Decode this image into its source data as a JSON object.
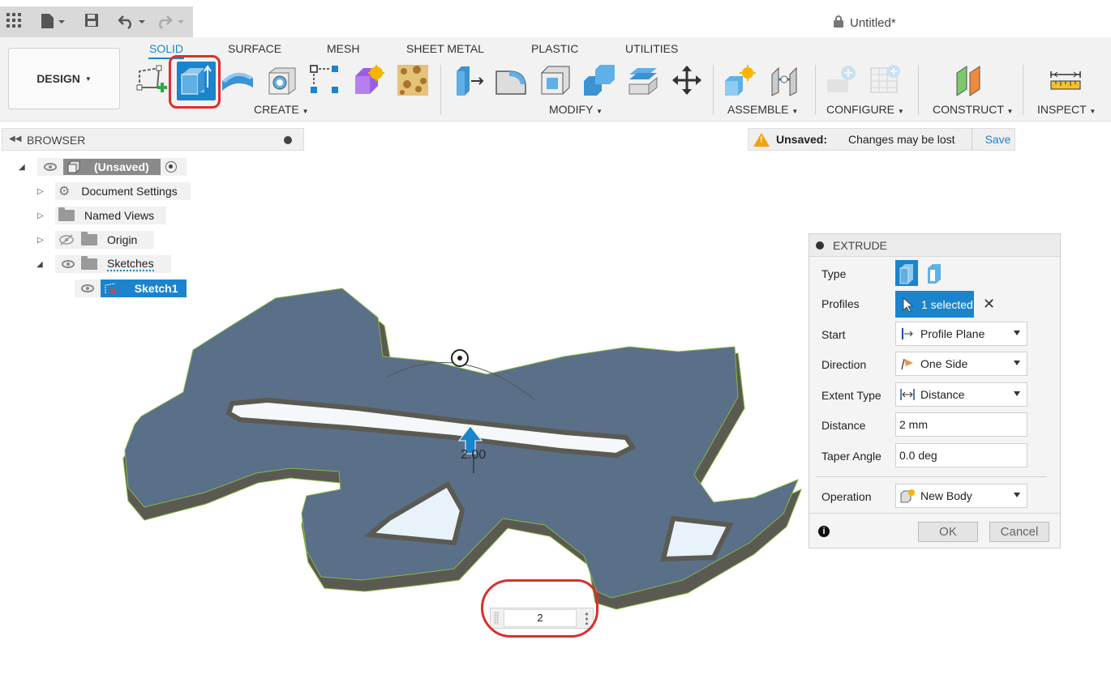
{
  "window": {
    "title": "Untitled*"
  },
  "ribbon": {
    "workspace_label": "DESIGN",
    "tabs": [
      {
        "label": "SOLID",
        "active": true
      },
      {
        "label": "SURFACE"
      },
      {
        "label": "MESH"
      },
      {
        "label": "SHEET METAL"
      },
      {
        "label": "PLASTIC"
      },
      {
        "label": "UTILITIES"
      }
    ],
    "groups": {
      "create": "CREATE",
      "modify": "MODIFY",
      "assemble": "ASSEMBLE",
      "configure": "CONFIGURE",
      "construct": "CONSTRUCT",
      "inspect": "INSPECT"
    }
  },
  "browser": {
    "title": "BROWSER",
    "items": [
      {
        "label": "(Unsaved)"
      },
      {
        "label": "Document Settings"
      },
      {
        "label": "Named Views"
      },
      {
        "label": "Origin"
      },
      {
        "label": "Sketches"
      },
      {
        "label": "Sketch1"
      }
    ]
  },
  "unsaved_bar": {
    "status": "Unsaved:",
    "message": "Changes may be lost",
    "save_label": "Save"
  },
  "extrude": {
    "title": "EXTRUDE",
    "type_label": "Type",
    "profiles_label": "Profiles",
    "profiles_value": "1 selected",
    "start_label": "Start",
    "start_value": "Profile Plane",
    "direction_label": "Direction",
    "direction_value": "One Side",
    "extent_label": "Extent Type",
    "extent_value": "Distance",
    "distance_label": "Distance",
    "distance_value": "2 mm",
    "taper_label": "Taper Angle",
    "taper_value": "0.0 deg",
    "operation_label": "Operation",
    "operation_value": "New Body",
    "ok_label": "OK",
    "cancel_label": "Cancel"
  },
  "viewport": {
    "dimension_value": "2",
    "manipulator_label": "2.00"
  },
  "colors": {
    "accent": "#1b84cc",
    "annotation": "#d9302c",
    "body_face": "#5a6f88",
    "body_side": "#5b5a52"
  }
}
